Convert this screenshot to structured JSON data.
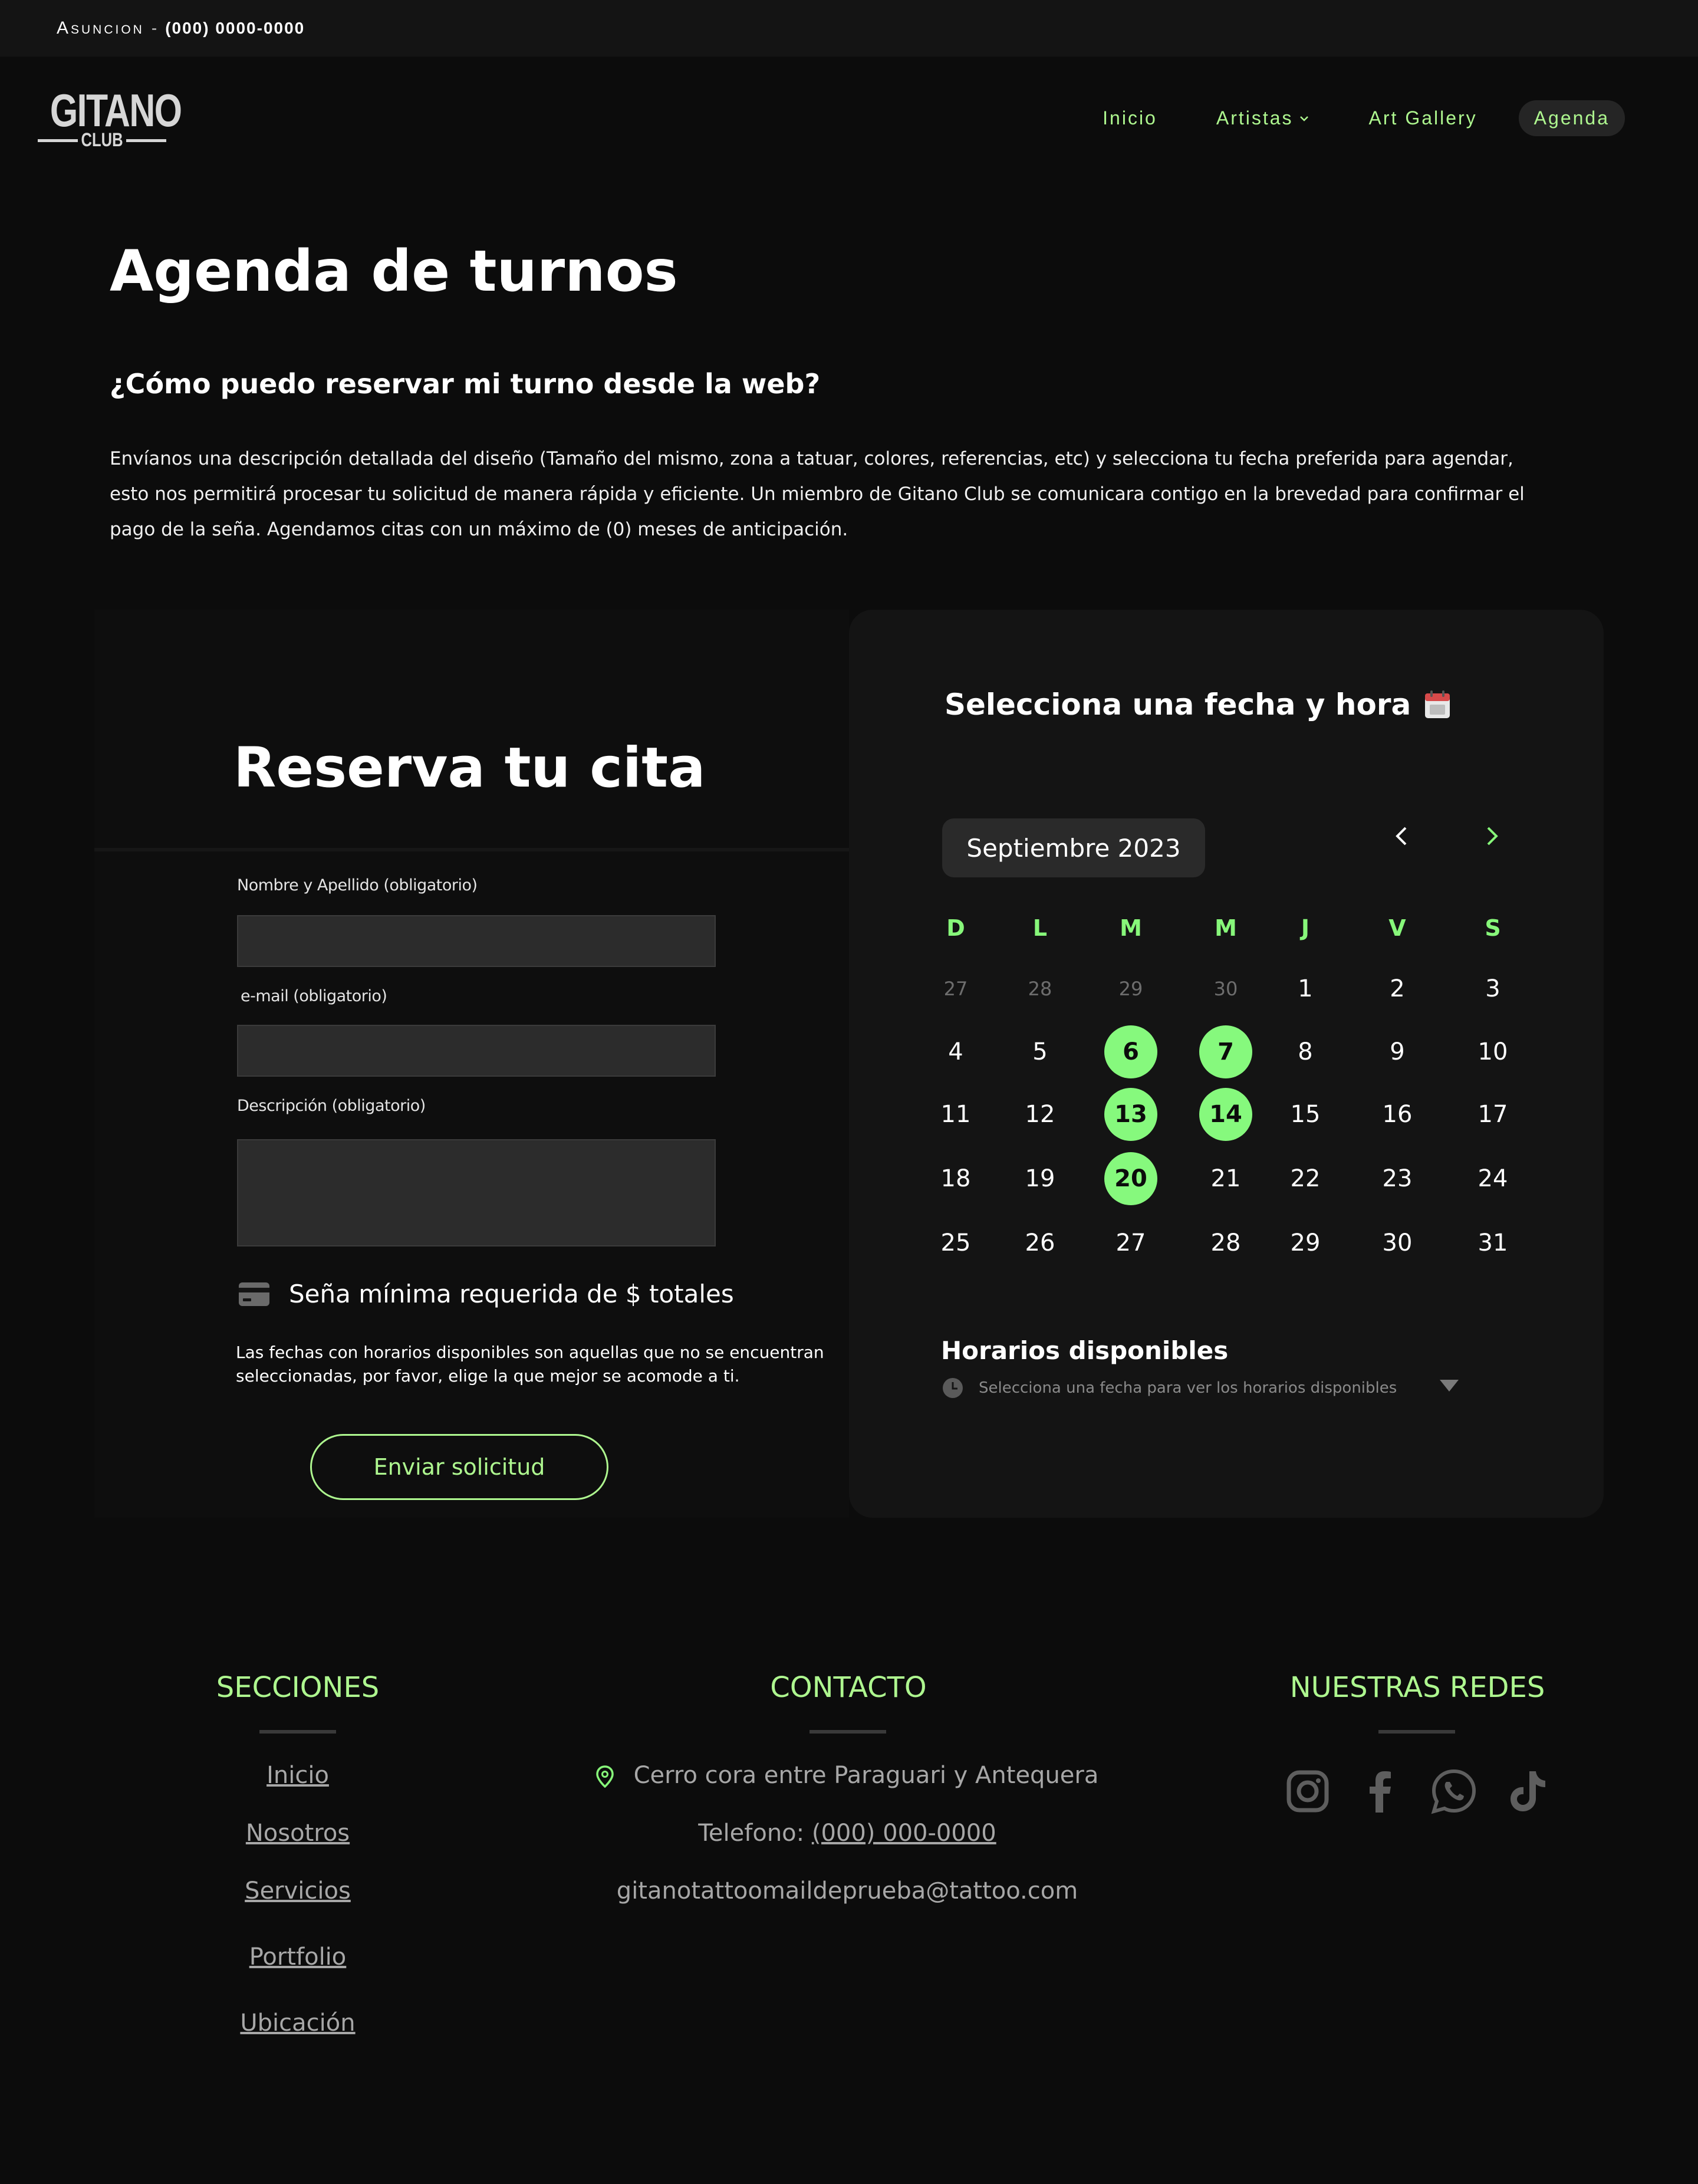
{
  "topbar": {
    "city": "Asuncion",
    "separator": "-",
    "phone": "(000) 0000-0000"
  },
  "logo": {
    "line1": "GITANO",
    "line2": "CLUB"
  },
  "nav": {
    "items": [
      "Inicio",
      "Artistas",
      "Art Gallery",
      "Agenda"
    ],
    "active": "Agenda"
  },
  "page": {
    "title": "Agenda de turnos",
    "subtitle": "¿Cómo puedo reservar mi turno desde la web?",
    "intro": "Envíanos una descripción detallada del diseño (Tamaño del mismo, zona a tatuar, colores, referencias, etc) y selecciona tu fecha preferida para agendar, esto nos permitirá procesar tu solicitud de manera rápida y eficiente. Un miembro de Gitano Club se comunicara contigo en la brevedad para confirmar el pago de la seña. Agendamos citas con un máximo de (0) meses de anticipación."
  },
  "form": {
    "title": "Reserva tu cita",
    "name_label": "Nombre y Apellido (obligatorio)",
    "email_label": "e-mail (obligatorio)",
    "desc_label": "Descripción (obligatorio)",
    "deposit": "Seña mínima requerida de $ totales",
    "note": "Las fechas con horarios disponibles son aquellas que no se encuentran seleccionadas, por favor, elige la que mejor se acomode a ti.",
    "submit": "Enviar solicitud"
  },
  "calendar": {
    "title": "Selecciona una fecha y hora",
    "month": "Septiembre 2023",
    "weekdays": [
      "D",
      "L",
      "M",
      "M",
      "J",
      "V",
      "S"
    ],
    "weeks": [
      [
        "27",
        "28",
        "29",
        "30",
        "1",
        "2",
        "3"
      ],
      [
        "4",
        "5",
        "6",
        "7",
        "8",
        "9",
        "10"
      ],
      [
        "11",
        "12",
        "13",
        "14",
        "15",
        "16",
        "17"
      ],
      [
        "18",
        "19",
        "20",
        "21",
        "22",
        "23",
        "24"
      ],
      [
        "25",
        "26",
        "27",
        "28",
        "29",
        "30",
        "31"
      ]
    ],
    "outside_month_days": [
      "27",
      "28",
      "29",
      "30"
    ],
    "available_days": [
      "6",
      "7",
      "13",
      "14",
      "20"
    ],
    "slots_title": "Horarios disponibles",
    "slots_hint": "Selecciona una fecha para ver los horarios disponibles"
  },
  "footer": {
    "sections_title": "SECCIONES",
    "sections": [
      "Inicio",
      "Nosotros",
      "Servicios",
      "Portfolio",
      "Ubicación"
    ],
    "contact_title": "CONTACTO",
    "address": "Cerro cora entre Paraguari y Antequera",
    "phone_label": "Telefono:",
    "phone": "(000) 000-0000",
    "email": "gitanotattoomaildeprueba@tattoo.com",
    "social_title": "NUESTRAS REDES",
    "social": [
      "instagram-icon",
      "facebook-icon",
      "whatsapp-icon",
      "tiktok-icon"
    ]
  },
  "colors": {
    "accent": "#aef78f",
    "available": "#86f97d",
    "background": "#0c0c0c",
    "card": "#141414"
  }
}
